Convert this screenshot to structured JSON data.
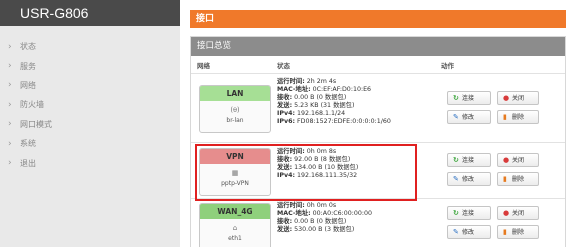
{
  "app": {
    "title": "USR-G806"
  },
  "sidebar": {
    "items": [
      {
        "label": "状态"
      },
      {
        "label": "服务"
      },
      {
        "label": "网络"
      },
      {
        "label": "防火墙"
      },
      {
        "label": "网口模式"
      },
      {
        "label": "系统"
      },
      {
        "label": "退出"
      }
    ]
  },
  "main": {
    "section_title": "接口",
    "panel_title": "接口总览",
    "columns": {
      "net": "网络",
      "status": "状态",
      "action": "动作"
    },
    "buttons": {
      "connect": "连接",
      "close": "关闭",
      "edit": "修改",
      "delete": "删除"
    },
    "interfaces": [
      {
        "name": "LAN",
        "icon": "network-bridge-icon",
        "icon_text": "(ᵾ̈)",
        "device": "br-lan",
        "status": [
          {
            "key": "运行时间:",
            "value": " 2h 2m 4s"
          },
          {
            "key": "MAC-地址:",
            "value": " 0C:EF:AF:D0:10:E6"
          },
          {
            "key": "接收:",
            "value": " 0.00 B (0 数据包)"
          },
          {
            "key": "发送:",
            "value": " 5.23 KB (31 数据包)"
          },
          {
            "key": "IPv4:",
            "value": " 192.168.1.1/24"
          },
          {
            "key": "IPv6:",
            "value": " FD08:1527:EDFE:0:0:0:0:1/60"
          }
        ]
      },
      {
        "name": "VPN",
        "icon": "vpn-icon",
        "icon_text": "▦",
        "device": "pptp-VPN",
        "status": [
          {
            "key": "运行时间:",
            "value": " 0h 0m 8s"
          },
          {
            "key": "接收:",
            "value": " 92.00 B (8 数据包)"
          },
          {
            "key": "发送:",
            "value": " 134.00 B (10 数据包)"
          },
          {
            "key": "IPv4:",
            "value": " 192.168.111.35/32"
          }
        ]
      },
      {
        "name": "WAN_4G",
        "icon": "ethernet-port-icon",
        "icon_text": "⌂",
        "device": "eth1",
        "status": [
          {
            "key": "运行时间:",
            "value": " 0h 0m 0s"
          },
          {
            "key": "MAC-地址:",
            "value": " 00:A0:C6:00:00:00"
          },
          {
            "key": "接收:",
            "value": " 0.00 B (0 数据包)"
          },
          {
            "key": "发送:",
            "value": " 530.00 B (3 数据包)"
          }
        ]
      }
    ]
  },
  "colors": {
    "accent": "#f0792a",
    "sidebar_bg": "#e9e9e9",
    "brand_bg": "#4a4a4a",
    "panel_header_bg": "#8c8c8c",
    "lan_green": "#a6df95",
    "vpn_red": "#e68d8d",
    "highlight_red": "#e02020"
  }
}
